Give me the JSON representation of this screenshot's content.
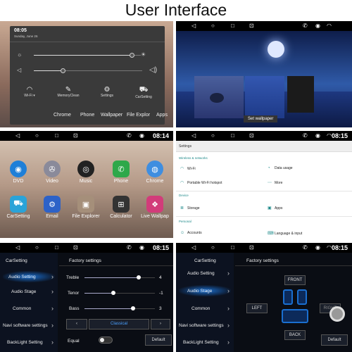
{
  "title": "User Interface",
  "panel1": {
    "time": "08:05",
    "date": "Sunday, June 26",
    "quick_settings": [
      "Wi-Fi",
      "MemoryClean",
      "Settings",
      "CarSetting"
    ],
    "dock": [
      "Chrome",
      "Phone",
      "Wallpaper",
      "File Explor",
      "Apps"
    ]
  },
  "panel2": {
    "set_wallpaper": "Set wallpaper"
  },
  "panel3": {
    "time": "08:14",
    "apps_row1": [
      "DVD",
      "Video",
      "Music",
      "Phone",
      "Chrome"
    ],
    "apps_row2": [
      "CarSetting",
      "Email",
      "File Explorer",
      "Calculator",
      "Live Wallpap"
    ]
  },
  "panel4": {
    "time": "08:15",
    "header": "Settings",
    "section1": "Wireless & networks",
    "wifi": "Wi-Fi",
    "data_usage": "Data usage",
    "hotspot": "Portable Wi-Fi hotspot",
    "more": "More",
    "section2": "Device",
    "storage": "Storage",
    "apps": "Apps",
    "section3": "Personal",
    "accounts": "Accounts",
    "language": "Language & input"
  },
  "panel5": {
    "time": "08:15",
    "side_title": "CarSetting",
    "menu": [
      "Audio Setting",
      "Audio Stage",
      "Common",
      "Navi software settings",
      "BackLight Setting"
    ],
    "factory": "Factory settings",
    "treble_label": "Treble",
    "treble": 4,
    "tenor_label": "Tenor",
    "tenor": -1,
    "bass_label": "Bass",
    "bass": 3,
    "preset": "Classical",
    "equal": "Equal",
    "default": "Default"
  },
  "panel6": {
    "time": "08:15",
    "side_title": "CarSetting",
    "menu": [
      "Audio Setting",
      "Audio Stage",
      "Common",
      "Navi software settings",
      "BackLight Setting"
    ],
    "factory": "Factory settings",
    "front": "FRONT",
    "left": "LEFT",
    "right": "RIGHT",
    "back": "BACK",
    "default": "Default"
  },
  "colors": {
    "accent": "#1e8a8a",
    "dark_bg": "#0a0d14",
    "highlight": "#1a6fd0"
  }
}
